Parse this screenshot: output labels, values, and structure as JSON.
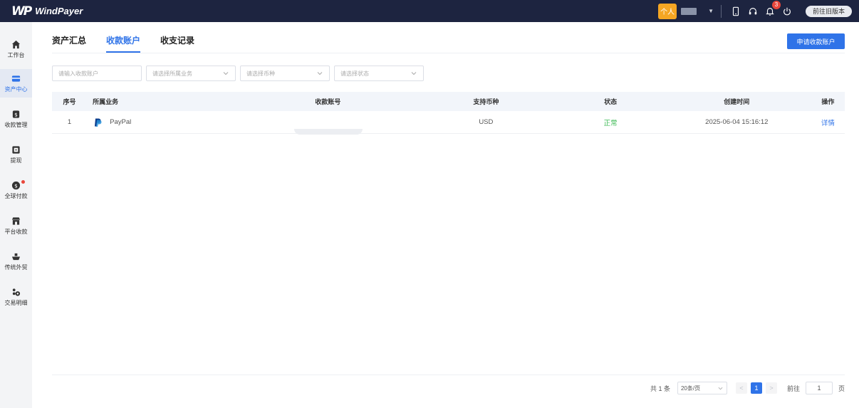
{
  "app": {
    "logo_mark": "WP",
    "logo_text": "WindPayer"
  },
  "topbar": {
    "personal_badge": "个人",
    "notification_count": "3",
    "old_version_label": "前往旧版本",
    "icons": [
      "tablet-icon",
      "headset-icon",
      "bell-icon",
      "power-icon"
    ]
  },
  "sidebar": {
    "items": [
      {
        "label": "工作台",
        "icon": "home-icon"
      },
      {
        "label": "资产中心",
        "icon": "wallet-card-icon",
        "active": true
      },
      {
        "label": "收款管理",
        "icon": "money-bag-icon"
      },
      {
        "label": "提现",
        "icon": "withdraw-icon"
      },
      {
        "label": "全球付款",
        "icon": "dollar-coin-icon",
        "dot": true
      },
      {
        "label": "平台收款",
        "icon": "store-icon"
      },
      {
        "label": "传统外贸",
        "icon": "ship-icon"
      },
      {
        "label": "交易明细",
        "icon": "transactions-icon"
      }
    ]
  },
  "tabs": [
    {
      "label": "资产汇总"
    },
    {
      "label": "收款账户",
      "active": true
    },
    {
      "label": "收支记录"
    }
  ],
  "apply_button": "申请收款账户",
  "filters": [
    {
      "placeholder": "请输入收款账户",
      "type": "input"
    },
    {
      "placeholder": "请选择所属业务",
      "type": "select"
    },
    {
      "placeholder": "请选择币种",
      "type": "select"
    },
    {
      "placeholder": "请选择状态",
      "type": "select"
    }
  ],
  "table": {
    "columns": [
      "序号",
      "所属业务",
      "收款账号",
      "支持币种",
      "状态",
      "创建时间",
      "操作"
    ],
    "rows": [
      {
        "index": "1",
        "business": "PayPal",
        "account": "",
        "currency": "USD",
        "status": "正常",
        "created": "2025-06-04 15:16:12",
        "action": "详情"
      }
    ]
  },
  "pagination": {
    "total": "共 1 条",
    "page_size": "20条/页",
    "prev": "<",
    "current_page": "1",
    "next": ">",
    "goto_label": "前往",
    "goto_value": "1",
    "page_suffix": "页"
  },
  "colors": {
    "topbar": "#1d2440",
    "accent": "#2f73e8",
    "status_ok": "#3cba54",
    "badge": "#f5a623"
  }
}
